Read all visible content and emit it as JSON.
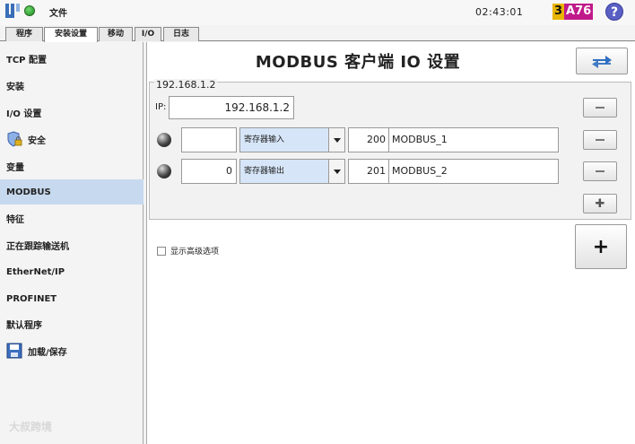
{
  "topbar": {
    "file_menu": "文件",
    "clock": "02:43:01",
    "version_a": "3",
    "version_b": "A76",
    "help_glyph": "?",
    "status_color": "#1c8a1c"
  },
  "tabs": [
    {
      "label": "程序"
    },
    {
      "label": "安装设置"
    },
    {
      "label": "移动"
    },
    {
      "label": "I/O"
    },
    {
      "label": "日志"
    }
  ],
  "sidebar": {
    "items": [
      {
        "label": "TCP 配置"
      },
      {
        "label": "安装"
      },
      {
        "label": "I/O 设置"
      },
      {
        "label": "安全",
        "icon": "shield-lock-icon"
      },
      {
        "label": "变量"
      },
      {
        "label": "MODBUS",
        "selected": true
      },
      {
        "label": "特征"
      },
      {
        "label": "正在跟踪输送机"
      },
      {
        "label": "EtherNet/IP"
      },
      {
        "label": "PROFINET"
      },
      {
        "label": "默认程序"
      },
      {
        "label": "加载/保存",
        "icon": "save-disk-icon"
      }
    ],
    "watermark": "大叔跨境"
  },
  "main": {
    "title": "MODBUS 客户端 IO 设置",
    "server": {
      "legend": "192.168.1.2",
      "ip_label": "IP:",
      "ip_value": "192.168.1.2",
      "signals": [
        {
          "value": "",
          "type": "寄存器输入",
          "address": "200",
          "name": "MODBUS_1"
        },
        {
          "value": "0",
          "type": "寄存器输出",
          "address": "201",
          "name": "MODBUS_2"
        }
      ]
    },
    "advanced_label": "显示高级选项",
    "add_label": "+"
  }
}
